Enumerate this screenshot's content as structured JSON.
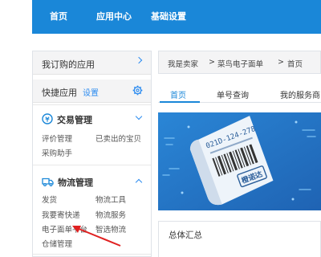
{
  "nav": {
    "items": [
      "首页",
      "应用中心",
      "基础设置"
    ],
    "accent": "#1a87d8"
  },
  "sidebar": {
    "purchased_apps": "我订购的应用",
    "quick_apps": "快捷应用",
    "quick_settings": "设置",
    "sections": [
      {
        "title": "交易管理",
        "icon": "transaction-icon",
        "expanded": true,
        "links": [
          "评价管理",
          "已卖出的宝贝",
          "采购助手"
        ]
      },
      {
        "title": "物流管理",
        "icon": "logistics-icon",
        "expanded": true,
        "links": [
          "发货",
          "物流工具",
          "我要寄快递",
          "物流服务",
          "电子面单平台",
          "智选物流",
          "仓储管理"
        ]
      }
    ]
  },
  "breadcrumb": {
    "parts": [
      "我是卖家",
      ">",
      "菜鸟电子面单",
      ">",
      "首页"
    ]
  },
  "tabs": [
    "首页",
    "单号查询",
    "我的服务商"
  ],
  "banner": {
    "tracking_number": "021D-124-278",
    "stamp": "橙诺达",
    "bg_color": "#2474c5"
  },
  "summary": {
    "title": "总体汇总"
  }
}
